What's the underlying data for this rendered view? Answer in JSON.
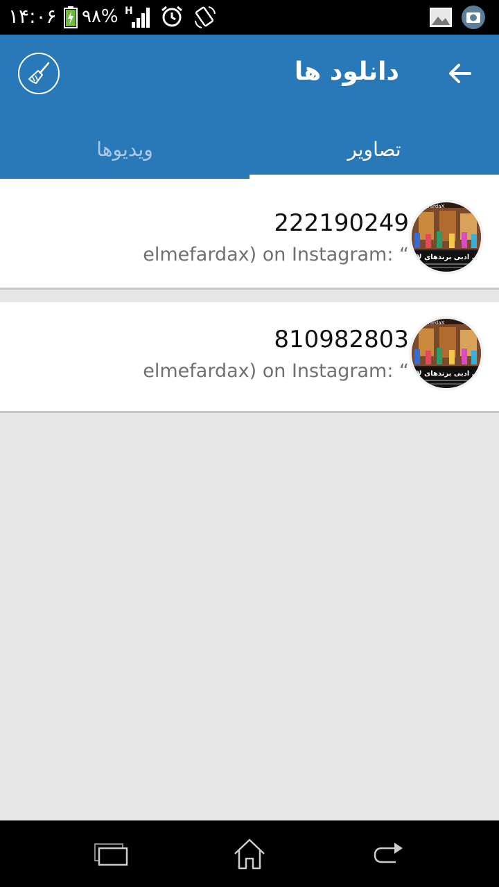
{
  "status_bar": {
    "time": "۱۴:۰۶",
    "battery_percent": "۹۸%",
    "network": "H",
    "icons": [
      "battery-charging-icon",
      "signal-icon",
      "alarm-icon",
      "rotate-icon",
      "gallery-icon",
      "camera-icon"
    ]
  },
  "app_bar": {
    "title": "دانلود ها",
    "back_icon": "arrow-right-icon",
    "clean_icon": "broom-icon",
    "color": "#2979b9"
  },
  "tabs": [
    {
      "label": "تصاویر",
      "selected": true
    },
    {
      "label": "ویدیوها",
      "selected": false
    }
  ],
  "downloads": [
    {
      "title": "222190249",
      "subtitle": "elmefardax) on Instagram: “"
    },
    {
      "title": "810982803",
      "subtitle": "elmefardax) on Instagram: “"
    }
  ],
  "thumbnail": {
    "brand": "elmeFardaX",
    "caption": "ی ادبی برندهای لاکشری"
  },
  "nav_bar": {
    "icons": [
      "recent-apps-icon",
      "home-icon",
      "back-icon"
    ]
  }
}
